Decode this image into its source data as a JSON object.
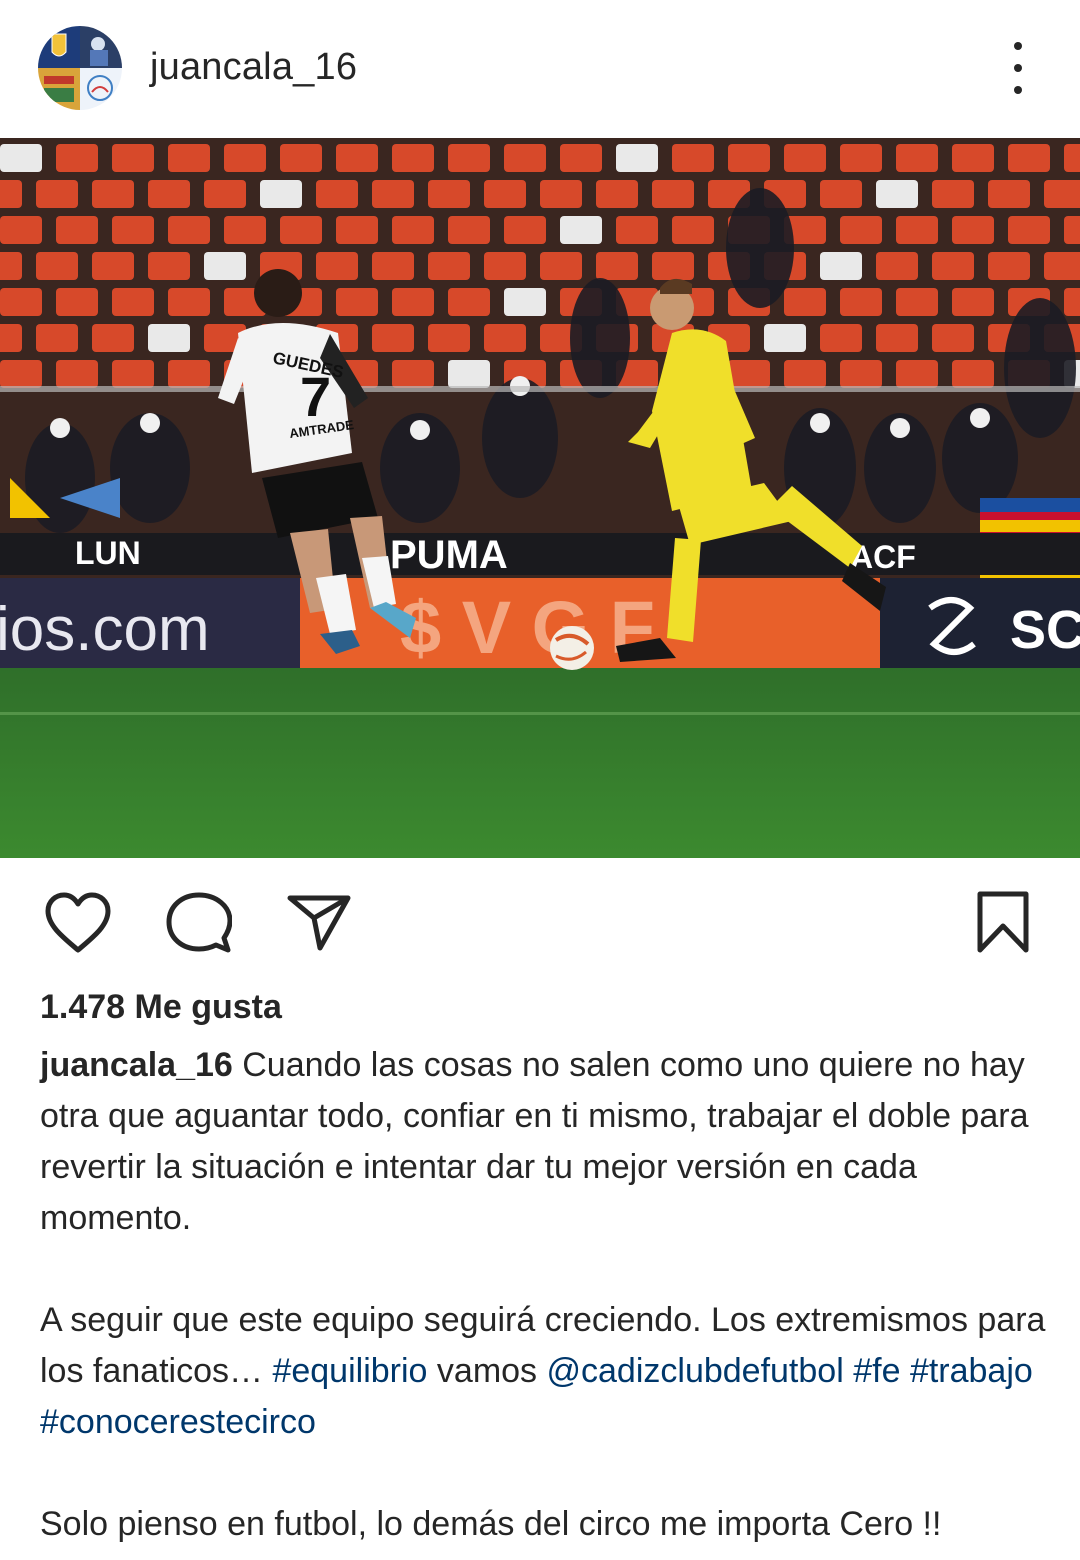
{
  "post": {
    "username": "juancala_16",
    "likes_text": "1.478 Me gusta",
    "caption": {
      "author": "juancala_16",
      "paragraph1": "Cuando las cosas no salen como uno quiere no hay otra que aguantar todo, confiar en ti mismo, trabajar el doble para revertir la situación e intentar dar tu mejor versión en cada momento.",
      "paragraph2_text": "A seguir que este equipo seguirá creciendo. Los extremismos para los fanaticos…",
      "hashtag_equilibrio": "#equilibrio",
      "word_vamos": "vamos",
      "mention": "@cadizclubdefutbol",
      "hashtag_fe": "#fe",
      "hashtag_trabajo": "#trabajo",
      "hashtag_circo": "#conocerestecirco",
      "paragraph3": "Solo pienso en futbol, lo demás del circo me importa Cero !!"
    },
    "photo": {
      "player_back_name": "GUEDES",
      "player_number": "7",
      "shirt_sponsor": "AMTRADE",
      "board_left_text": "ios.com",
      "board_puma": "PUMA",
      "board_lun": "LUN",
      "board_acf": "ACF"
    }
  },
  "icons": {
    "more": "more-vertical-icon",
    "like": "heart-icon",
    "comment": "comment-icon",
    "share": "send-icon",
    "save": "bookmark-icon"
  },
  "colors": {
    "text": "#262626",
    "link": "#00376b",
    "background": "#ffffff"
  }
}
